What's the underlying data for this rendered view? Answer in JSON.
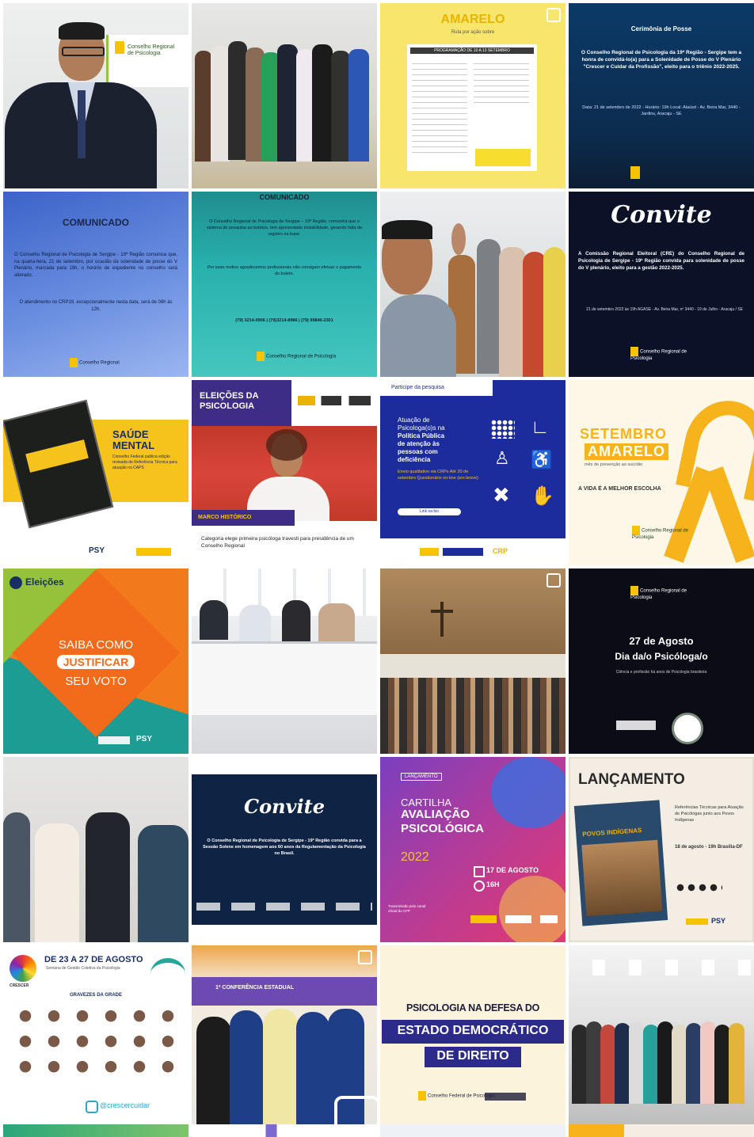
{
  "tiles": [
    {
      "id": "t1",
      "kind": "photo",
      "sign_lines": [
        "Conselho Regional",
        "de Psicologia"
      ]
    },
    {
      "id": "t2",
      "kind": "photo"
    },
    {
      "id": "t3",
      "kind": "poster",
      "heading": "AMARELO",
      "sub": "Ruta por ação sobre",
      "banner": "PROGRAMAÇÃO DE 10 A 13 SETEMBRO"
    },
    {
      "id": "t4",
      "kind": "post",
      "title": "Cerimônia de Posse",
      "body": "O Conselho Regional de Psicologia da 19ª Região - Sergipe tem a honra de convidá-lo(a) para a Solenidade de Posse do V Plenário \"Crescer e Cuidar da Profissão\", eleito para o triênio 2022-2025.",
      "details": "Data: 21 de setembro de 2022 - Horário: 19h Local: Alaúsd - Av. Beira Mar, 3440 - Jardins, Aracaju - SE"
    },
    {
      "id": "t5",
      "kind": "post",
      "title": "COMUNICADO",
      "body": "O Conselho Regional de Psicologia de Sergipe - 19ª Região comunica que, na quarta-feira, 21 de setembro, por ocasião da solenidade de posse do V Plenário, marcada para 19h, o horário de expediente no conselho será alterado.",
      "body2": "O atendimento no CRP19, excepcionalmente nesta data, será de 08h às 12h.",
      "logo": "Conselho Regional"
    },
    {
      "id": "t6",
      "kind": "post",
      "title": "COMUNICADO",
      "body": "O Conselho Regional de Psicologia de Sergipe – 19ª Região, comunica que o sistema de pesquisa ao boletos, tem apresentado instabilidade, gerando falta de registro na base.",
      "body2": "Por esse motivo agradecemos profissionais não consigam efetuar o pagamento do boleto.",
      "phones": "(79) 3214-0906 | (79)3214-8986 | (79) 99840-2301",
      "logo": "Conselho Regional de Psicologia"
    },
    {
      "id": "t7",
      "kind": "photo"
    },
    {
      "id": "t8",
      "kind": "post",
      "title": "Convite",
      "body": "A Comissão Regional Eleitoral (CRE) do Conselho Regional de Psicologia de Sergipe - 19ª Região convida para solenidade de posse do V plenário, eleito para a gestão 2022-2025.",
      "details": "21 de setembro 2022 às 19h AGASE - Av. Beira Mar, nº 3440 - 19 de Julho - Aracaju / SE",
      "logo": "Conselho Regional de Psicologia"
    },
    {
      "id": "t9",
      "kind": "post",
      "title_lines": [
        "SAÚDE",
        "MENTAL"
      ],
      "body": "Conselho Federal publica edição revisada de Referência Técnica para atuação no CAPS",
      "footer": "PSY"
    },
    {
      "id": "t10",
      "kind": "post",
      "title_lines": [
        "ELEIÇÕES DA",
        "PSICOLOGIA"
      ],
      "tag": "MARCO HISTÓRICO",
      "caption": "Categoria elege primeira psicóloga travesti para presidência de um Conselho Regional"
    },
    {
      "id": "t11",
      "kind": "post",
      "top": "Participe da pesquisa",
      "body_lines": [
        "Atuação de",
        "Psicologa(o)s na",
        "Política Pública",
        "de atenção às",
        "pessoas com",
        "deficiência"
      ],
      "note": "Envio qualitativo via CRPs Até 30 de setembro Questionário on-line (em breve)",
      "button": "Link na bio",
      "footer": "CRP"
    },
    {
      "id": "t12",
      "kind": "post",
      "title_lines": [
        "SETEMBRO",
        "AMARELO"
      ],
      "sub": "mês de prevenção ao suicídio",
      "slogan": "A VIDA É A MELHOR ESCOLHA",
      "logo": "Conselho Regional de Psicologia"
    },
    {
      "id": "t13",
      "kind": "post",
      "brand": "Eleições",
      "lines": [
        "SAIBA COMO",
        "JUSTIFICAR",
        "SEU VOTO"
      ],
      "footer": "PSY"
    },
    {
      "id": "t14",
      "kind": "photo"
    },
    {
      "id": "t15",
      "kind": "photo"
    },
    {
      "id": "t16",
      "kind": "post",
      "logo": "Conselho Regional de Psicologia",
      "title_lines": [
        "27 de Agosto",
        "Dia da/o Psicóloga/o"
      ],
      "sub": "Ciência e profissão há anos de Psicologia brasileira"
    },
    {
      "id": "t17",
      "kind": "photo"
    },
    {
      "id": "t18",
      "kind": "post",
      "title": "Convite",
      "body": "O Conselho Regional de Psicologia de Sergipe - 19ª Região convida para a Sessão Solene em homenagem aos 60 anos da Regulamentação da Psicologia no Brasil."
    },
    {
      "id": "t19",
      "kind": "post",
      "tag": "LANÇAMENTO",
      "title_lines": [
        "CARTILHA",
        "AVALIAÇÃO",
        "PSICOLÓGICA"
      ],
      "year": "2022",
      "date": "17 DE AGOSTO",
      "time": "16H",
      "note": "Transmissão pelo canal oficial do CFP"
    },
    {
      "id": "t20",
      "kind": "post",
      "title": "LANÇAMENTO",
      "book": "POVOS INDÍGENAS",
      "side": "Referências Técnicas para Atuação de Psicólogas junto aos Povos Indígenas",
      "date": "18 de agosto - 19h Brasília-DF",
      "footer": "PSY"
    },
    {
      "id": "t21",
      "kind": "post",
      "title": "DE 23 A 27 DE AGOSTO",
      "sub": "Semana de Gestão Coletiva da Psicologia",
      "brand": "CRESCER",
      "label": "GRAVEZES DA GRADE",
      "handle": "@crescercuidar"
    },
    {
      "id": "t22",
      "kind": "photo",
      "banner": "1ª CONFERÊNCIA ESTADUAL"
    },
    {
      "id": "t23",
      "kind": "post",
      "lines": [
        "PSICOLOGIA NA DEFESA DO",
        "ESTADO DEMOCRÁTICO",
        "DE DIREITO"
      ],
      "logo": "Conselho Federal de Psicologia"
    },
    {
      "id": "t24",
      "kind": "photo"
    }
  ]
}
